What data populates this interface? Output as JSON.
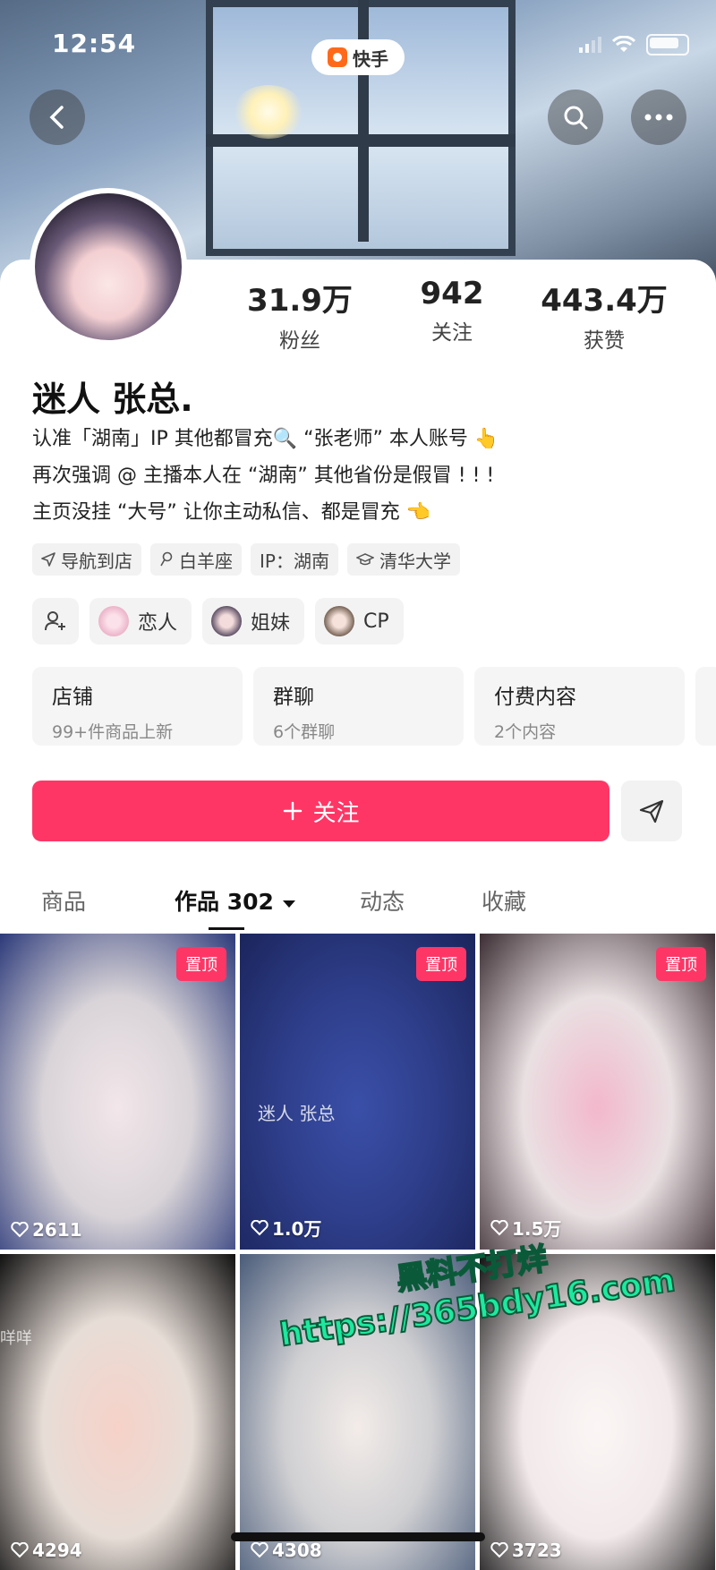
{
  "status_bar": {
    "time": "12:54",
    "app_name": "快手"
  },
  "header": {
    "back_icon": "chevron-left-icon",
    "search_icon": "search-icon",
    "more_icon": "more-dots-icon"
  },
  "profile": {
    "stats": [
      {
        "value": "31.9万",
        "label": "粉丝"
      },
      {
        "value": "942",
        "label": "关注"
      },
      {
        "value": "443.4万",
        "label": "获赞"
      }
    ],
    "name": "迷人 张总.",
    "bio": [
      "认准「湖南」IP 其他都冒充🔍 “张老师” 本人账号 👆",
      "再次强调 @ 主播本人在 “湖南” 其他省份是假冒 ! ! !",
      "主页没挂 “大号” 让你主动私信、都是冒充 👈"
    ],
    "tags": [
      "导航到店",
      "白羊座",
      "IP：湖南",
      "清华大学"
    ],
    "relations": [
      "恋人",
      "姐妹",
      "CP"
    ],
    "boxes": [
      {
        "title": "店铺",
        "sub": "99+件商品上新"
      },
      {
        "title": "群聊",
        "sub": "6个群聊"
      },
      {
        "title": "付费内容",
        "sub": "2个内容"
      }
    ],
    "follow_label": "关注"
  },
  "tabs": [
    "商品",
    "作品 302",
    "动态",
    "收藏"
  ],
  "videos": [
    {
      "pinned": "置顶",
      "likes": "2611",
      "colors": [
        "#d9d4d8",
        "#f2e6ea",
        "#2c3a7a"
      ]
    },
    {
      "pinned": "置顶",
      "likes": "1.0万",
      "colors": [
        "#2f3f8c",
        "#3a4fa8",
        "#1b255c"
      ],
      "watermark": "迷人 张总"
    },
    {
      "pinned": "置顶",
      "likes": "1.5万",
      "colors": [
        "#e9e0e2",
        "#f3b8cc",
        "#3b2d33"
      ]
    },
    {
      "likes": "4294",
      "colors": [
        "#e7ddd7",
        "#f6d2c8",
        "#111111"
      ],
      "side_text": "咩咩"
    },
    {
      "likes": "4308",
      "colors": [
        "#cfcfd2",
        "#f3ece9",
        "#4a5c7a"
      ]
    },
    {
      "likes": "3723",
      "colors": [
        "#f2e9ea",
        "#fbf6f5",
        "#111111"
      ]
    }
  ],
  "overlay": {
    "line1": "黑料不打烊",
    "line2": "https://365bdy16.com"
  }
}
